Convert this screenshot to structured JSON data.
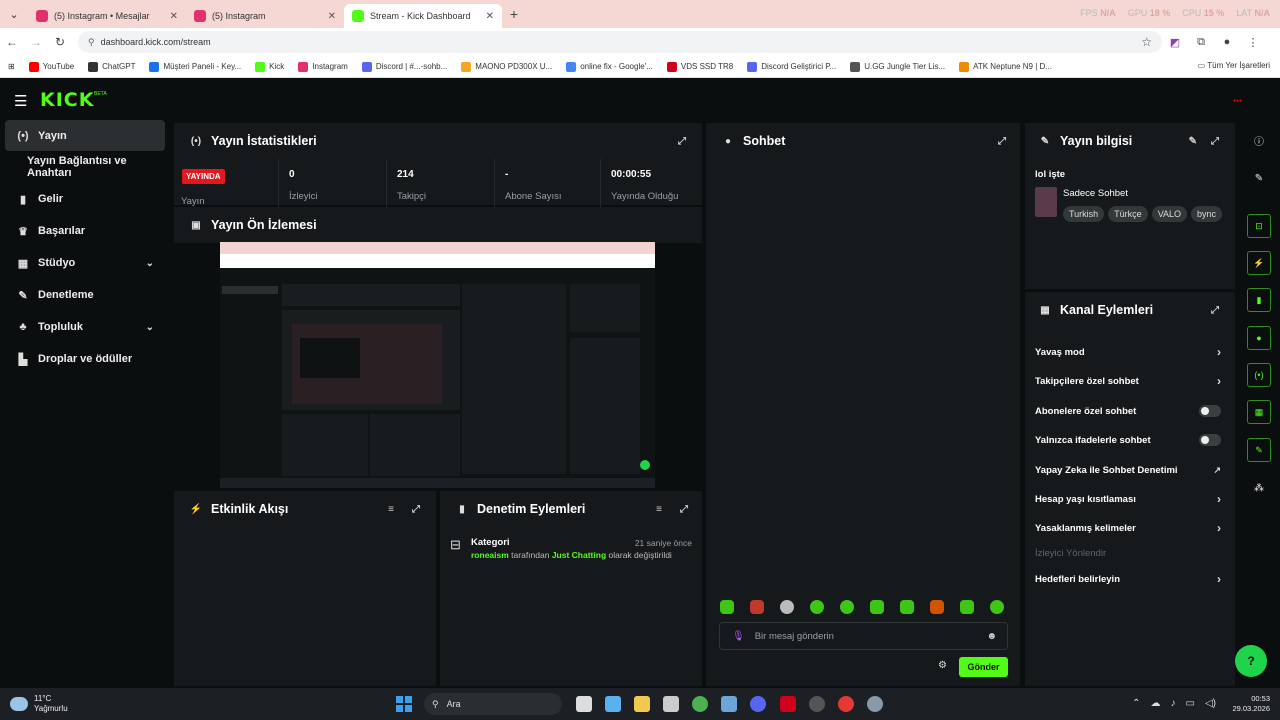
{
  "browser": {
    "tabs": [
      {
        "title": "(5) Instagram • Mesajlar",
        "color": "#e1306c"
      },
      {
        "title": "(5) Instagram",
        "color": "#e1306c"
      },
      {
        "title": "Stream - Kick Dashboard",
        "color": "#53fc18"
      }
    ],
    "perf": {
      "fps_label": "FPS",
      "fps": "N/A",
      "gpu_label": "GPU",
      "gpu": "18 %",
      "cpu_label": "CPU",
      "cpu": "15 %",
      "lat_label": "LAT",
      "lat": "N/A"
    },
    "url": "dashboard.kick.com/stream",
    "bookmarks": [
      {
        "label": "YouTube",
        "color": "#ff0000"
      },
      {
        "label": "ChatGPT",
        "color": "#333333"
      },
      {
        "label": "Müşteri Paneli - Key...",
        "color": "#1a73e8"
      },
      {
        "label": "Kick",
        "color": "#53fc18"
      },
      {
        "label": "Instagram",
        "color": "#e1306c"
      },
      {
        "label": "Discord | #...-sohb...",
        "color": "#5865f2"
      },
      {
        "label": "MAONO PD300X U...",
        "color": "#f5a623"
      },
      {
        "label": "online fix - Google'...",
        "color": "#4285f4"
      },
      {
        "label": "VDS SSD TR8",
        "color": "#d0021b"
      },
      {
        "label": "Discord Geliştirici P...",
        "color": "#5865f2"
      },
      {
        "label": "U.GG Jungle Tier Lis...",
        "color": "#555555"
      },
      {
        "label": "ATK Neptune N9 | D...",
        "color": "#f08a00"
      }
    ],
    "bookmarks_all": "Tüm Yer İşaretleri"
  },
  "app": {
    "logo": "KICK",
    "beta": "BETA",
    "sidebar": [
      {
        "label": "Yayın",
        "icon": "broadcast-icon",
        "glyph": "(•)",
        "active": true
      },
      {
        "label": "Yayın Bağlantısı ve Anahtarı",
        "sub": true
      },
      {
        "label": "Gelir",
        "icon": "chart-icon",
        "glyph": "▮"
      },
      {
        "label": "Başarılar",
        "icon": "trophy-icon",
        "glyph": "♛"
      },
      {
        "label": "Stüdyo",
        "icon": "studio-icon",
        "glyph": "▦",
        "chevron": true
      },
      {
        "label": "Denetleme",
        "icon": "wrench-icon",
        "glyph": "✎"
      },
      {
        "label": "Topluluk",
        "icon": "community-icon",
        "glyph": "♣",
        "chevron": true
      },
      {
        "label": "Droplar ve ödüller",
        "icon": "gift-icon",
        "glyph": "▙"
      }
    ],
    "stats": {
      "title": "Yayın İstatistikleri",
      "live_badge": "YAYINDA",
      "live_label": "Yayın",
      "items": [
        {
          "value": "0",
          "label": "İzleyici"
        },
        {
          "value": "214",
          "label": "Takipçi"
        },
        {
          "value": "-",
          "label": "Abone Sayısı"
        },
        {
          "value": "00:00:55",
          "label": "Yayında Olduğu"
        }
      ]
    },
    "preview": {
      "title": "Yayın Ön İzlemesi"
    },
    "activity": {
      "title": "Etkinlik Akışı"
    },
    "moderation": {
      "title": "Denetim Eylemleri",
      "event": {
        "type": "Kategori",
        "time": "21 saniye önce",
        "user": "roneaism",
        "middle": "tarafından",
        "category": "Just Chatting",
        "suffix": "olarak değiştirildi"
      }
    },
    "chat": {
      "title": "Sohbet",
      "placeholder": "Bir mesaj gönderin",
      "send": "Gönder"
    },
    "stream_info": {
      "title": "Yayın bilgisi",
      "stream_title": "lol işte",
      "mode": "Sadece Sohbet",
      "tags": [
        "Turkish",
        "Türkçe",
        "VALO",
        "bync"
      ]
    },
    "channel_actions": {
      "title": "Kanal Eylemleri",
      "items": [
        {
          "label": "Yavaş mod",
          "control": "arrow"
        },
        {
          "label": "Takipçilere özel sohbet",
          "control": "arrow"
        },
        {
          "label": "Abonelere özel sohbet",
          "control": "toggle"
        },
        {
          "label": "Yalnızca ifadelerle sohbet",
          "control": "toggle"
        },
        {
          "label": "Yapay Zeka ile Sohbet Denetimi",
          "control": "external"
        },
        {
          "label": "Hesap yaşı kısıtlaması",
          "control": "arrow"
        },
        {
          "label": "Yasaklanmış kelimeler",
          "control": "arrow"
        },
        {
          "label": "İzleyici Yönlendir",
          "control": "none",
          "disabled": true
        },
        {
          "label": "Hedefleri belirleyin",
          "control": "arrow"
        }
      ]
    }
  },
  "taskbar": {
    "weather_temp": "11°C",
    "weather_desc": "Yağmurlu",
    "search": "Ara",
    "time": "00:53",
    "date": "29.03.2026"
  }
}
